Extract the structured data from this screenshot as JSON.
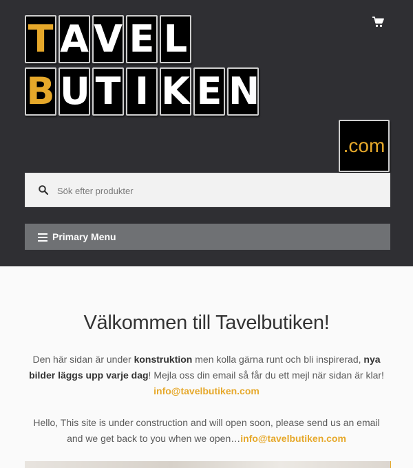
{
  "logo": {
    "row1": [
      "T",
      "A",
      "V",
      "E",
      "L"
    ],
    "row2": [
      "B",
      "U",
      "T",
      "I",
      "K",
      "E",
      "N"
    ],
    "domain": ".com",
    "accent_color": "#e6a82a"
  },
  "header": {
    "cart_icon": "shopping-cart-icon"
  },
  "search": {
    "placeholder": "Sök efter produkter",
    "icon": "search-icon"
  },
  "menu": {
    "label": "Primary Menu",
    "icon": "hamburger-icon"
  },
  "main": {
    "title": "Välkommen till Tavelbutiken!",
    "para1": {
      "t1": "Den här sidan är under ",
      "b1": "konstruktion",
      "t2": " men kolla gärna runt och bli inspirerad, ",
      "b2": "nya bilder läggs upp varje dag",
      "t3": "! Mejla oss din email så får du ett mejl när sidan är klar! ",
      "link": "info@tavelbutiken.com"
    },
    "para2": {
      "t1": "Hello, This site is under construction and will open soon, please send us an email and we get back to you when we open…",
      "link": "info@tavelbutiken.com"
    }
  }
}
